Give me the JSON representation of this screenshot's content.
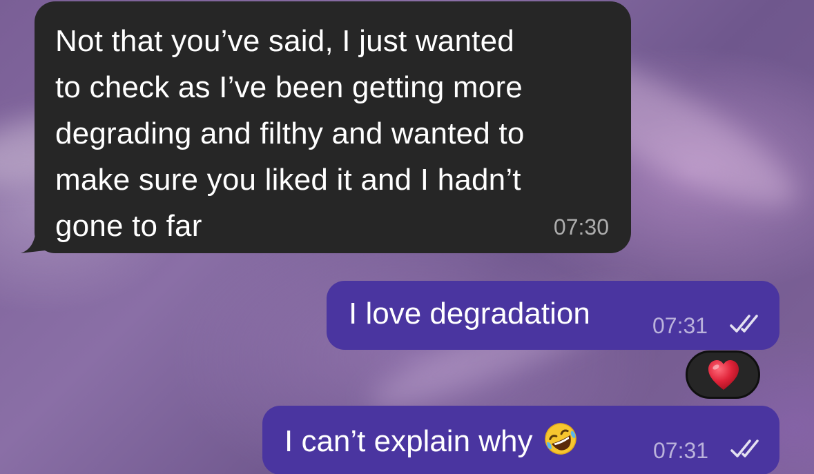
{
  "messages": [
    {
      "direction": "incoming",
      "text": "Not that you’ve said, I just wanted\nto check as I’ve been getting more\ndegrading and filthy and wanted to\nmake sure you liked it and I hadn’t\ngone to far",
      "time": "07:30"
    },
    {
      "direction": "outgoing",
      "text": "I love degradation",
      "time": "07:31",
      "status": "read",
      "reaction": "❤️"
    },
    {
      "direction": "outgoing",
      "text": "I can’t explain why",
      "emoji": "rolling-on-the-floor-laughing-emoji",
      "time": "07:31",
      "status": "read"
    }
  ],
  "colors": {
    "incoming_bubble": "#262626",
    "outgoing_bubble": "#4a35a0",
    "reaction_heart": "#e0243a"
  },
  "icons": {
    "read_receipt": "double-check-icon",
    "reaction": "heart-icon"
  }
}
